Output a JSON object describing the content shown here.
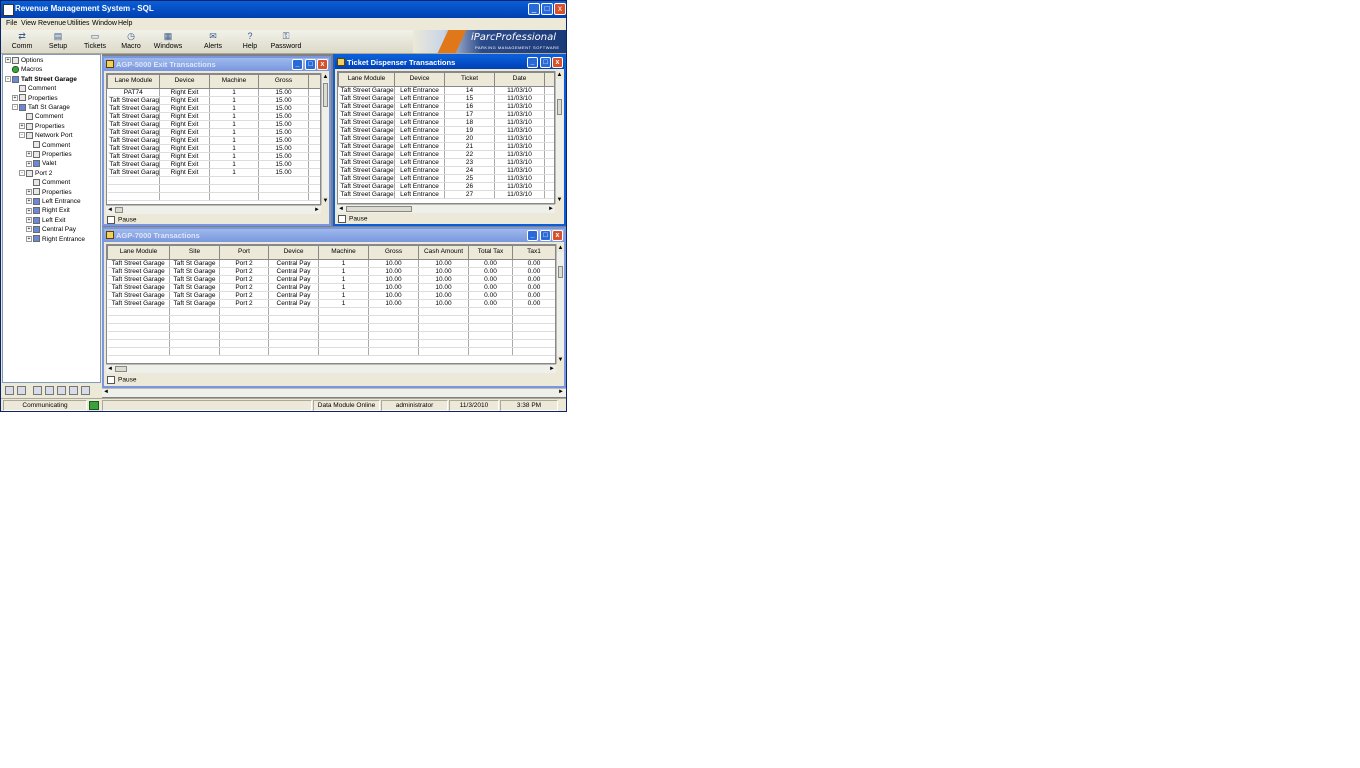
{
  "window": {
    "title": "Revenue Management System - SQL",
    "min": "_",
    "max": "□",
    "close": "x"
  },
  "menu": [
    "File",
    "View",
    "Revenue",
    "Utilities",
    "Window",
    "Help"
  ],
  "toolbar": [
    {
      "label": "Comm",
      "icon": "comm-icon"
    },
    {
      "label": "Setup",
      "icon": "setup-icon"
    },
    {
      "label": "Tickets",
      "icon": "tickets-icon"
    },
    {
      "label": "Macro",
      "icon": "macro-icon"
    },
    {
      "label": "Windows",
      "icon": "windows-icon"
    },
    {
      "label": "Alerts",
      "icon": "alerts-icon"
    },
    {
      "label": "Help",
      "icon": "help-icon"
    },
    {
      "label": "Password",
      "icon": "password-icon"
    }
  ],
  "brand": {
    "name": "iParcProfessional",
    "sub": "PARKING MANAGEMENT SOFTWARE"
  },
  "tree": [
    {
      "label": "Options",
      "level": 0,
      "exp": "+",
      "icon": "options-icon"
    },
    {
      "label": "Macros",
      "level": 0,
      "exp": "",
      "icon": "macros-icon"
    },
    {
      "label": "Taft Street Garage",
      "level": 0,
      "exp": "-",
      "icon": "garage-icon",
      "bold": true
    },
    {
      "label": "Comment",
      "level": 1,
      "exp": "",
      "icon": "comment-icon"
    },
    {
      "label": "Properties",
      "level": 1,
      "exp": "+",
      "icon": "properties-icon"
    },
    {
      "label": "Taft St Garage",
      "level": 1,
      "exp": "-",
      "icon": "site-icon"
    },
    {
      "label": "Comment",
      "level": 2,
      "exp": "",
      "icon": "comment-icon"
    },
    {
      "label": "Properties",
      "level": 2,
      "exp": "+",
      "icon": "properties-icon"
    },
    {
      "label": "Network Port",
      "level": 2,
      "exp": "-",
      "icon": "network-port-icon"
    },
    {
      "label": "Comment",
      "level": 3,
      "exp": "",
      "icon": "comment-icon"
    },
    {
      "label": "Properties",
      "level": 3,
      "exp": "+",
      "icon": "properties-icon"
    },
    {
      "label": "Valet",
      "level": 3,
      "exp": "+",
      "icon": "device-icon"
    },
    {
      "label": "Port 2",
      "level": 2,
      "exp": "-",
      "icon": "port-icon"
    },
    {
      "label": "Comment",
      "level": 3,
      "exp": "",
      "icon": "comment-icon"
    },
    {
      "label": "Properties",
      "level": 3,
      "exp": "+",
      "icon": "properties-icon"
    },
    {
      "label": "Left Entrance",
      "level": 3,
      "exp": "+",
      "icon": "device-icon"
    },
    {
      "label": "Right Exit",
      "level": 3,
      "exp": "+",
      "icon": "device-icon"
    },
    {
      "label": "Left Exit",
      "level": 3,
      "exp": "+",
      "icon": "device-icon"
    },
    {
      "label": "Central Pay",
      "level": 3,
      "exp": "+",
      "icon": "device-icon"
    },
    {
      "label": "Right Entrance",
      "level": 3,
      "exp": "+",
      "icon": "device-icon"
    }
  ],
  "exit_window": {
    "title": "AGP-5000 Exit Transactions",
    "columns": [
      "Lane Module",
      "Device",
      "Machine",
      "Gross"
    ],
    "rows": [
      [
        "PAT74",
        "Right Exit",
        "1",
        "15.00"
      ],
      [
        "Taft Street Garage",
        "Right Exit",
        "1",
        "15.00"
      ],
      [
        "Taft Street Garage",
        "Right Exit",
        "1",
        "15.00"
      ],
      [
        "Taft Street Garage",
        "Right Exit",
        "1",
        "15.00"
      ],
      [
        "Taft Street Garage",
        "Right Exit",
        "1",
        "15.00"
      ],
      [
        "Taft Street Garage",
        "Right Exit",
        "1",
        "15.00"
      ],
      [
        "Taft Street Garage",
        "Right Exit",
        "1",
        "15.00"
      ],
      [
        "Taft Street Garage",
        "Right Exit",
        "1",
        "15.00"
      ],
      [
        "Taft Street Garage",
        "Right Exit",
        "1",
        "15.00"
      ],
      [
        "Taft Street Garage",
        "Right Exit",
        "1",
        "15.00"
      ],
      [
        "Taft Street Garage",
        "Right Exit",
        "1",
        "15.00"
      ]
    ],
    "pause": "Pause"
  },
  "ticket_window": {
    "title": "Ticket Dispenser Transactions",
    "columns": [
      "Lane Module",
      "Device",
      "Ticket",
      "Date"
    ],
    "rows": [
      [
        "Taft Street Garage",
        "Left Entrance",
        "14",
        "11/03/10"
      ],
      [
        "Taft Street Garage",
        "Left Entrance",
        "15",
        "11/03/10"
      ],
      [
        "Taft Street Garage",
        "Left Entrance",
        "16",
        "11/03/10"
      ],
      [
        "Taft Street Garage",
        "Left Entrance",
        "17",
        "11/03/10"
      ],
      [
        "Taft Street Garage",
        "Left Entrance",
        "18",
        "11/03/10"
      ],
      [
        "Taft Street Garage",
        "Left Entrance",
        "19",
        "11/03/10"
      ],
      [
        "Taft Street Garage",
        "Left Entrance",
        "20",
        "11/03/10"
      ],
      [
        "Taft Street Garage",
        "Left Entrance",
        "21",
        "11/03/10"
      ],
      [
        "Taft Street Garage",
        "Left Entrance",
        "22",
        "11/03/10"
      ],
      [
        "Taft Street Garage",
        "Left Entrance",
        "23",
        "11/03/10"
      ],
      [
        "Taft Street Garage",
        "Left Entrance",
        "24",
        "11/03/10"
      ],
      [
        "Taft Street Garage",
        "Left Entrance",
        "25",
        "11/03/10"
      ],
      [
        "Taft Street Garage",
        "Left Entrance",
        "26",
        "11/03/10"
      ],
      [
        "Taft Street Garage",
        "Left Entrance",
        "27",
        "11/03/10"
      ]
    ],
    "pause": "Pause"
  },
  "agp7000_window": {
    "title": "AGP-7000 Transactions",
    "columns": [
      "Lane Module",
      "Site",
      "Port",
      "Device",
      "Machine",
      "Gross",
      "Cash Amount",
      "Total Tax",
      "Tax1"
    ],
    "rows": [
      [
        "Taft Street Garage",
        "Taft St Garage",
        "Port 2",
        "Central Pay",
        "1",
        "10.00",
        "10.00",
        "0.00",
        "0.00"
      ],
      [
        "Taft Street Garage",
        "Taft St Garage",
        "Port 2",
        "Central Pay",
        "1",
        "10.00",
        "10.00",
        "0.00",
        "0.00"
      ],
      [
        "Taft Street Garage",
        "Taft St Garage",
        "Port 2",
        "Central Pay",
        "1",
        "10.00",
        "10.00",
        "0.00",
        "0.00"
      ],
      [
        "Taft Street Garage",
        "Taft St Garage",
        "Port 2",
        "Central Pay",
        "1",
        "10.00",
        "10.00",
        "0.00",
        "0.00"
      ],
      [
        "Taft Street Garage",
        "Taft St Garage",
        "Port 2",
        "Central Pay",
        "1",
        "10.00",
        "10.00",
        "0.00",
        "0.00"
      ],
      [
        "Taft Street Garage",
        "Taft St Garage",
        "Port 2",
        "Central Pay",
        "1",
        "10.00",
        "10.00",
        "0.00",
        "0.00"
      ]
    ],
    "pause": "Pause"
  },
  "status": {
    "communicating": "Communicating",
    "module": "Data Module Online",
    "user": "administrator",
    "date": "11/3/2010",
    "time": "3:38 PM"
  }
}
